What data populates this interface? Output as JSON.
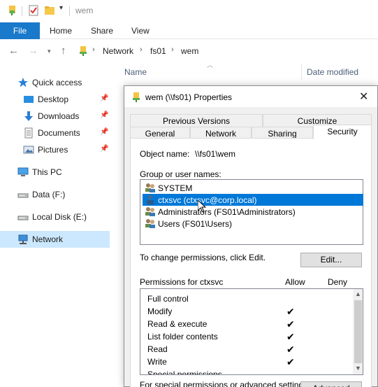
{
  "window": {
    "title": "wem"
  },
  "ribbon": {
    "tabs": [
      "File",
      "Home",
      "Share",
      "View"
    ]
  },
  "address": {
    "crumbs": [
      "Network",
      "fs01",
      "wem"
    ]
  },
  "nav": {
    "items": [
      {
        "label": "Quick access",
        "icon": "star-icon",
        "pinned": false
      },
      {
        "label": "Desktop",
        "icon": "desktop-icon",
        "pinned": true
      },
      {
        "label": "Downloads",
        "icon": "download-icon",
        "pinned": true
      },
      {
        "label": "Documents",
        "icon": "documents-icon",
        "pinned": true
      },
      {
        "label": "Pictures",
        "icon": "pictures-icon",
        "pinned": true
      },
      {
        "label": "This PC",
        "icon": "computer-icon",
        "pinned": false
      },
      {
        "label": "Data (F:)",
        "icon": "drive-icon",
        "pinned": false
      },
      {
        "label": "Local Disk (E:)",
        "icon": "drive-icon",
        "pinned": false
      },
      {
        "label": "Network",
        "icon": "network-icon",
        "pinned": false,
        "selected": true
      }
    ]
  },
  "filelist": {
    "columns": [
      "Name",
      "Date modified"
    ]
  },
  "dialog": {
    "title": "wem (\\\\fs01) Properties",
    "tabs_top": [
      "Previous Versions",
      "Customize"
    ],
    "tabs_bottom": [
      "General",
      "Network",
      "Sharing",
      "Security"
    ],
    "active_tab": "Security",
    "object_name_label": "Object name:",
    "object_name_value": "\\\\fs01\\wem",
    "group_label": "Group or user names:",
    "users": [
      {
        "label": "SYSTEM",
        "selected": false
      },
      {
        "label": "ctxsvc (ctxsvc@corp.local)",
        "selected": true
      },
      {
        "label": "Administrators (FS01\\Administrators)",
        "selected": false
      },
      {
        "label": "Users (FS01\\Users)",
        "selected": false
      }
    ],
    "change_text": "To change permissions, click Edit.",
    "edit_button": "Edit...",
    "permissions_for": "Permissions for ctxsvc",
    "allow_label": "Allow",
    "deny_label": "Deny",
    "permissions": [
      {
        "label": "Full control",
        "allow": false
      },
      {
        "label": "Modify",
        "allow": true
      },
      {
        "label": "Read & execute",
        "allow": true
      },
      {
        "label": "List folder contents",
        "allow": true
      },
      {
        "label": "Read",
        "allow": true
      },
      {
        "label": "Write",
        "allow": true
      },
      {
        "label": "Special permissions",
        "allow": false
      }
    ],
    "special_text": "For special permissions or advanced settings",
    "advanced_button": "Advanced",
    "check_glyph": "✔"
  },
  "colors": {
    "accent": "#1979ca",
    "selection": "#0078d7",
    "nav_selected": "#cce8ff"
  }
}
